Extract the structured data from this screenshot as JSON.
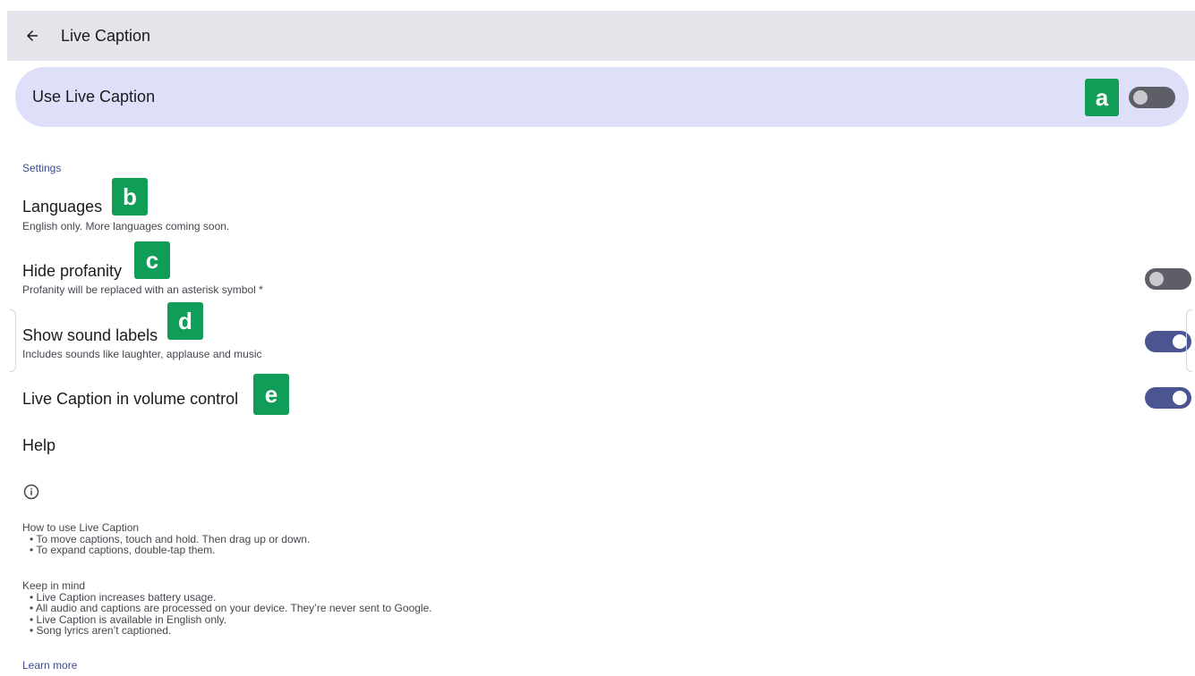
{
  "appbar": {
    "title": "Live Caption",
    "back_icon": "arrow-back-icon"
  },
  "main_toggle": {
    "label": "Use Live Caption",
    "state": "off"
  },
  "section": {
    "header": "Settings"
  },
  "rows": [
    {
      "title": "Languages",
      "subtitle": "English only. More languages coming soon."
    },
    {
      "title": "Hide profanity",
      "subtitle": "Profanity will be replaced with an asterisk symbol *",
      "state": "off"
    },
    {
      "title": "Show sound labels",
      "subtitle": "Includes sounds like laughter, applause and music",
      "state": "on"
    },
    {
      "title": "Live Caption in volume control",
      "state": "on"
    }
  ],
  "help": {
    "title": "Help"
  },
  "info": {
    "icon": "info-icon",
    "how_title": "How to use Live Caption",
    "how_items": [
      "To move captions, touch and hold. Then drag up or down.",
      "To expand captions, double-tap them."
    ],
    "keep_title": "Keep in mind",
    "keep_items": [
      "Live Caption increases battery usage.",
      "All audio and captions are processed on your device. They’re never sent to Google.",
      "Live Caption is available in English only.",
      "Song lyrics aren’t captioned."
    ],
    "learn_more": "Learn more"
  },
  "badges": [
    "a",
    "b",
    "c",
    "d",
    "e"
  ],
  "colors": {
    "accent": "#4a5591",
    "card": "#dde0f8",
    "badge": "#0f9d58",
    "appbar": "#e6e4ea"
  }
}
